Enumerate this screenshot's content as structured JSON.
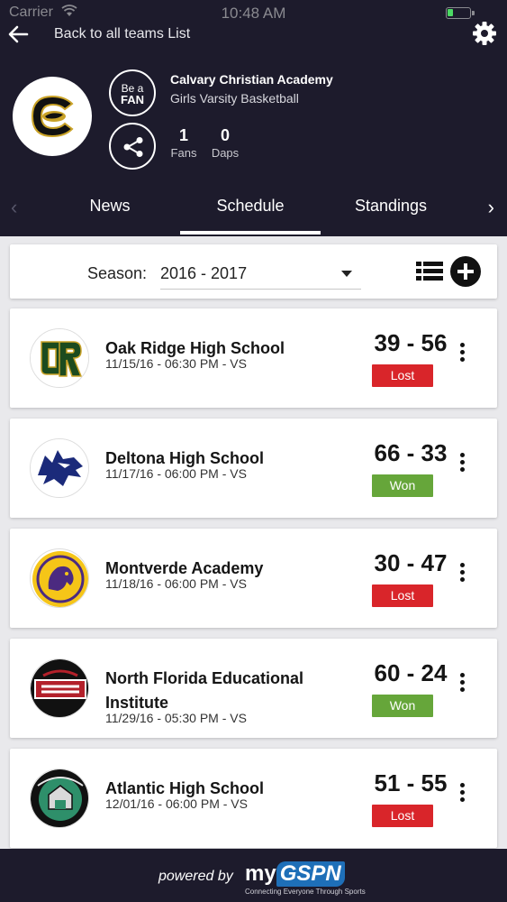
{
  "status_bar": {
    "carrier": "Carrier",
    "time": "10:48 AM"
  },
  "nav": {
    "back_label": "Back to all teams List"
  },
  "team": {
    "school": "Calvary Christian Academy",
    "team_type": "Girls Varsity Basketball",
    "fan_button": {
      "line1": "Be a",
      "line2": "FAN"
    },
    "stats": [
      {
        "value": "1",
        "label": "Fans"
      },
      {
        "value": "0",
        "label": "Daps"
      }
    ]
  },
  "tabs": [
    {
      "label": "News"
    },
    {
      "label": "Schedule",
      "active": true
    },
    {
      "label": "Standings"
    }
  ],
  "season": {
    "label": "Season:",
    "value": "2016 - 2017"
  },
  "games": [
    {
      "opponent": "Oak Ridge High School",
      "date": "11/15/16 - 06:30 PM - VS",
      "score": "39 - 56",
      "result": "Lost"
    },
    {
      "opponent": "Deltona High School",
      "date": "11/17/16 - 06:00 PM - VS",
      "score": "66 - 33",
      "result": "Won"
    },
    {
      "opponent": "Montverde Academy",
      "date": "11/18/16 - 06:00 PM - VS",
      "score": "30 - 47",
      "result": "Lost"
    },
    {
      "opponent": "North Florida Educational Institute",
      "date": "11/29/16 - 05:30 PM - VS",
      "score": "60 - 24",
      "result": "Won"
    },
    {
      "opponent": "Atlantic High School",
      "date": "12/01/16 - 06:00 PM - VS",
      "score": "51 - 55",
      "result": "Lost"
    }
  ],
  "footer": {
    "powered": "powered by",
    "brand_prefix": "my",
    "brand_name": "GSPN",
    "tagline": "Connecting Everyone Through Sports"
  },
  "colors": {
    "header_bg": "#1d1b2c",
    "lost": "#d9252a",
    "won": "#66a63a",
    "page_bg": "#e9e9ec"
  }
}
